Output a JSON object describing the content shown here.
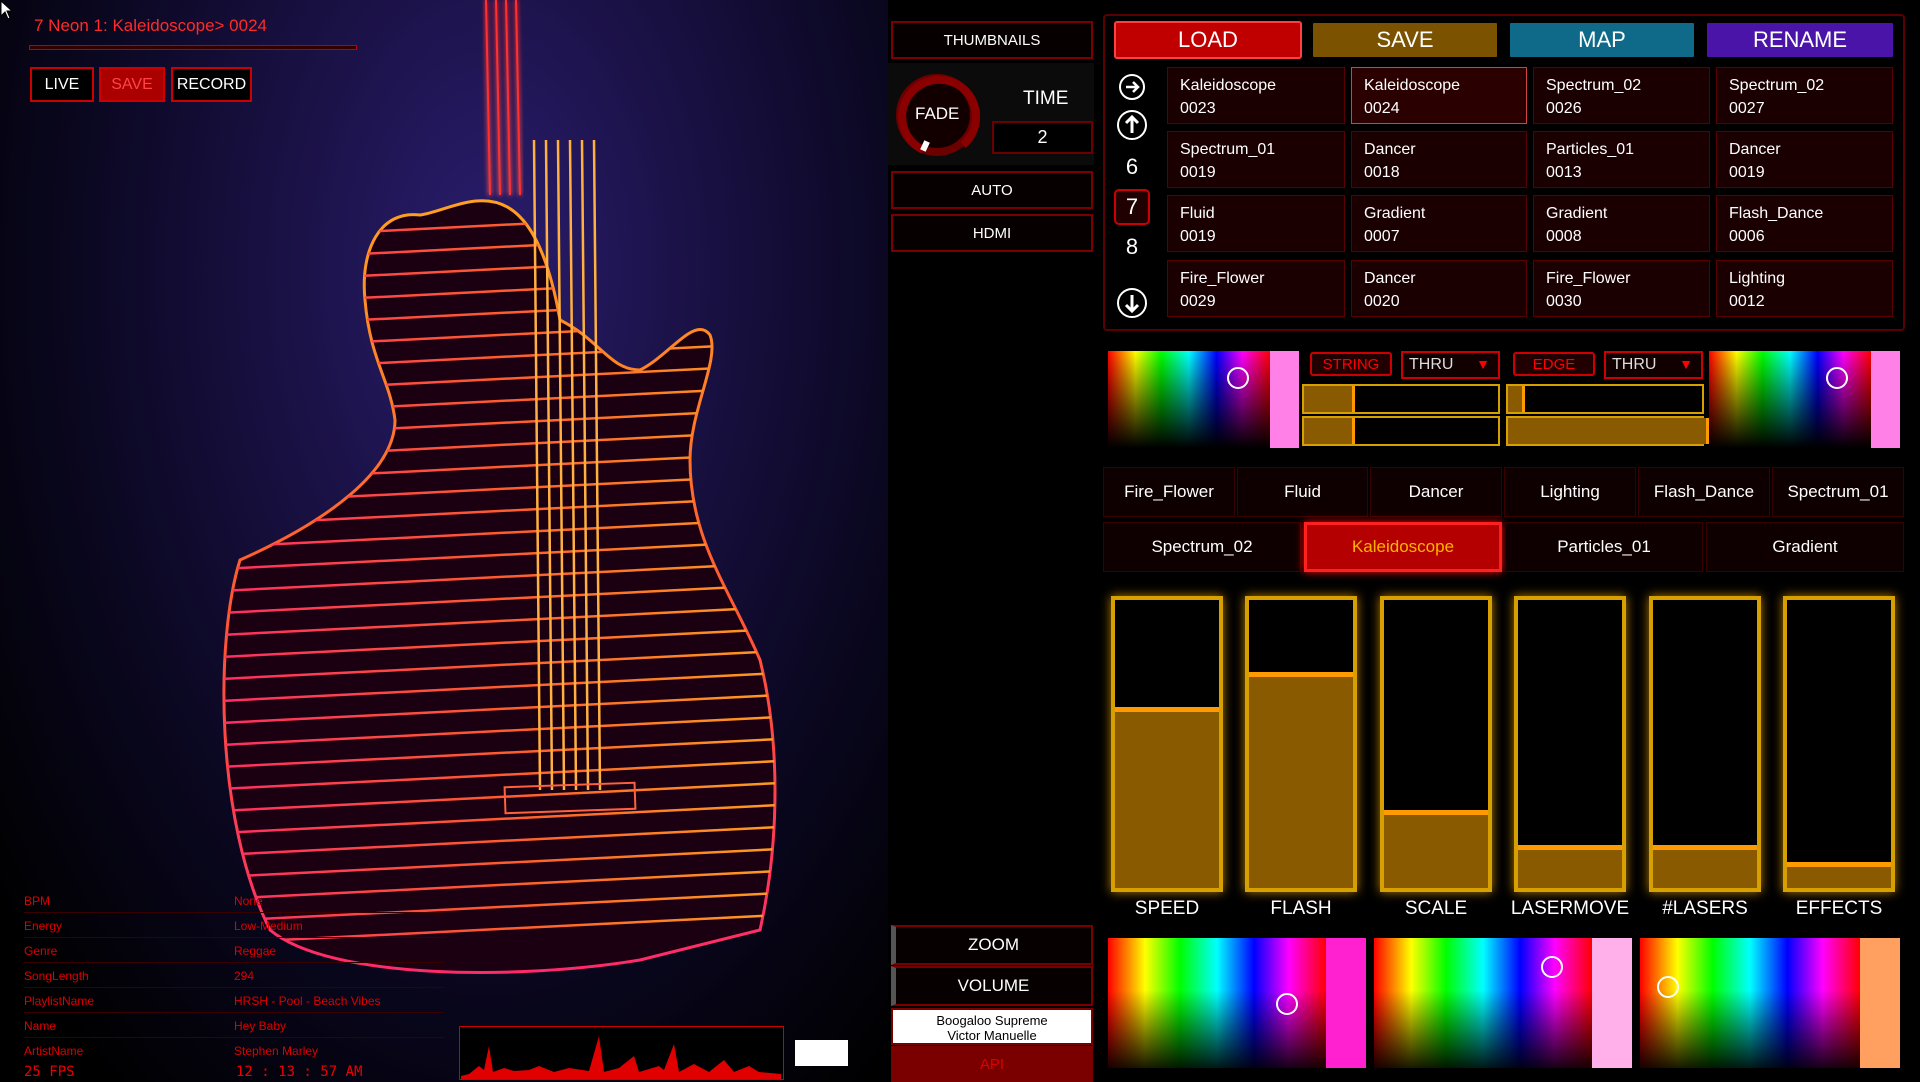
{
  "viewport": {
    "title": "7 Neon 1: Kaleidoscope> 0024",
    "buttons": {
      "live": "LIVE",
      "save": "SAVE",
      "record": "RECORD"
    },
    "meta": [
      {
        "key": "BPM",
        "value": "None"
      },
      {
        "key": "Energy",
        "value": "Low-Medium"
      },
      {
        "key": "Genre",
        "value": "Reggae"
      },
      {
        "key": "SongLength",
        "value": "294"
      },
      {
        "key": "PlaylistName",
        "value": "HRSH - Pool - Beach Vibes"
      },
      {
        "key": "Name",
        "value": "Hey Baby"
      },
      {
        "key": "ArtistName",
        "value": "Stephen Marley"
      }
    ],
    "fps": "25 FPS",
    "clock": "12 : 13 : 57 AM"
  },
  "middle": {
    "thumbnails": "THUMBNAILS",
    "fade": "FADE",
    "time_label": "TIME",
    "time_value": "2",
    "auto": "AUTO",
    "hdmi": "HDMI",
    "zoom": "ZOOM",
    "volume": "VOLUME",
    "song_line1": "Boogaloo Supreme",
    "song_line2": "Victor Manuelle",
    "api": "API"
  },
  "top_buttons": {
    "load": "LOAD",
    "save": "SAVE",
    "map": "MAP",
    "rename": "RENAME"
  },
  "top_colors": {
    "load": "#c00000",
    "save": "#7a5200",
    "map": "#0f6a8a",
    "rename": "#4a14a8"
  },
  "page_nav": {
    "current": "7",
    "prev": "6",
    "next": "8"
  },
  "presets": [
    {
      "name": "Kaleidoscope",
      "num": "0023"
    },
    {
      "name": "Kaleidoscope",
      "num": "0024"
    },
    {
      "name": "Spectrum_02",
      "num": "0026"
    },
    {
      "name": "Spectrum_02",
      "num": "0027"
    },
    {
      "name": "Spectrum_01",
      "num": "0019"
    },
    {
      "name": "Dancer",
      "num": "0018"
    },
    {
      "name": "Particles_01",
      "num": "0013"
    },
    {
      "name": "Dancer",
      "num": "0019"
    },
    {
      "name": "Fluid",
      "num": "0019"
    },
    {
      "name": "Gradient",
      "num": "0007"
    },
    {
      "name": "Gradient",
      "num": "0008"
    },
    {
      "name": "Flash_Dance",
      "num": "0006"
    },
    {
      "name": "Fire_Flower",
      "num": "0029"
    },
    {
      "name": "Dancer",
      "num": "0020"
    },
    {
      "name": "Fire_Flower",
      "num": "0030"
    },
    {
      "name": "Lighting",
      "num": "0012"
    }
  ],
  "color_controls": {
    "string_label": "STRING",
    "string_mode": "THRU",
    "edge_label": "EDGE",
    "edge_mode": "THRU"
  },
  "effect_tabs_row1": [
    "Fire_Flower",
    "Fluid",
    "Dancer",
    "Lighting",
    "Flash_Dance",
    "Spectrum_01"
  ],
  "effect_tabs_row2": [
    "Spectrum_02",
    "Kaleidoscope",
    "Particles_01",
    "Gradient"
  ],
  "active_effect": "Kaleidoscope",
  "sliders": [
    {
      "label": "SPEED",
      "level": 0.63
    },
    {
      "label": "FLASH",
      "level": 0.75
    },
    {
      "label": "SCALE",
      "level": 0.27
    },
    {
      "label": "LASERMOVE",
      "level": 0.15
    },
    {
      "label": "#LASERS",
      "level": 0.15
    },
    {
      "label": "EFFECTS",
      "level": 0.09
    }
  ]
}
